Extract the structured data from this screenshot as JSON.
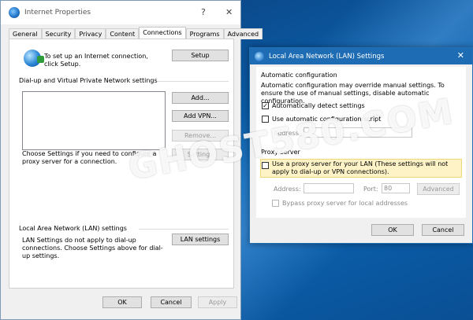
{
  "desktop": {
    "watermark": "GHOST580.COM"
  },
  "internet_properties": {
    "title": "Internet Properties",
    "help_glyph": "?",
    "close_glyph": "✕",
    "tabs": [
      "General",
      "Security",
      "Privacy",
      "Content",
      "Connections",
      "Programs",
      "Advanced"
    ],
    "active_tab": "Connections",
    "setup_text": "To set up an Internet connection, click Setup.",
    "setup_button": "Setup",
    "dialup_section": "Dial-up and Virtual Private Network settings",
    "add_button": "Add...",
    "add_vpn_button": "Add VPN...",
    "remove_button": "Remove...",
    "proxy_text": "Choose Settings if you need to configure a proxy server for a connection.",
    "settings_button": "Settings",
    "lan_section": "Local Area Network (LAN) settings",
    "lan_text": "LAN Settings do not apply to dial-up connections. Choose Settings above for dial-up settings.",
    "lan_settings_button": "LAN settings",
    "ok_button": "OK",
    "cancel_button": "Cancel",
    "apply_button": "Apply"
  },
  "lan_settings": {
    "title": "Local Area Network (LAN) Settings",
    "close_glyph": "✕",
    "auto_config_label": "Automatic configuration",
    "auto_config_desc": "Automatic configuration may override manual settings.  To ensure the use of manual settings, disable automatic configuration.",
    "auto_detect_label": "Automatically detect settings",
    "auto_detect_checked": true,
    "auto_script_label": "Use automatic configuration script",
    "auto_script_checked": false,
    "address_label": "Address",
    "proxy_group_label": "Proxy server",
    "use_proxy_label": "Use a proxy server for your LAN (These settings will not apply to dial-up or VPN connections).",
    "use_proxy_checked": false,
    "proxy_address_label": "Address:",
    "port_label": "Port:",
    "port_value": "80",
    "advanced_button": "Advanced",
    "bypass_label": "Bypass proxy server for local addresses",
    "bypass_checked": false,
    "ok_button": "OK",
    "cancel_button": "Cancel",
    "check_glyph": "✓"
  }
}
